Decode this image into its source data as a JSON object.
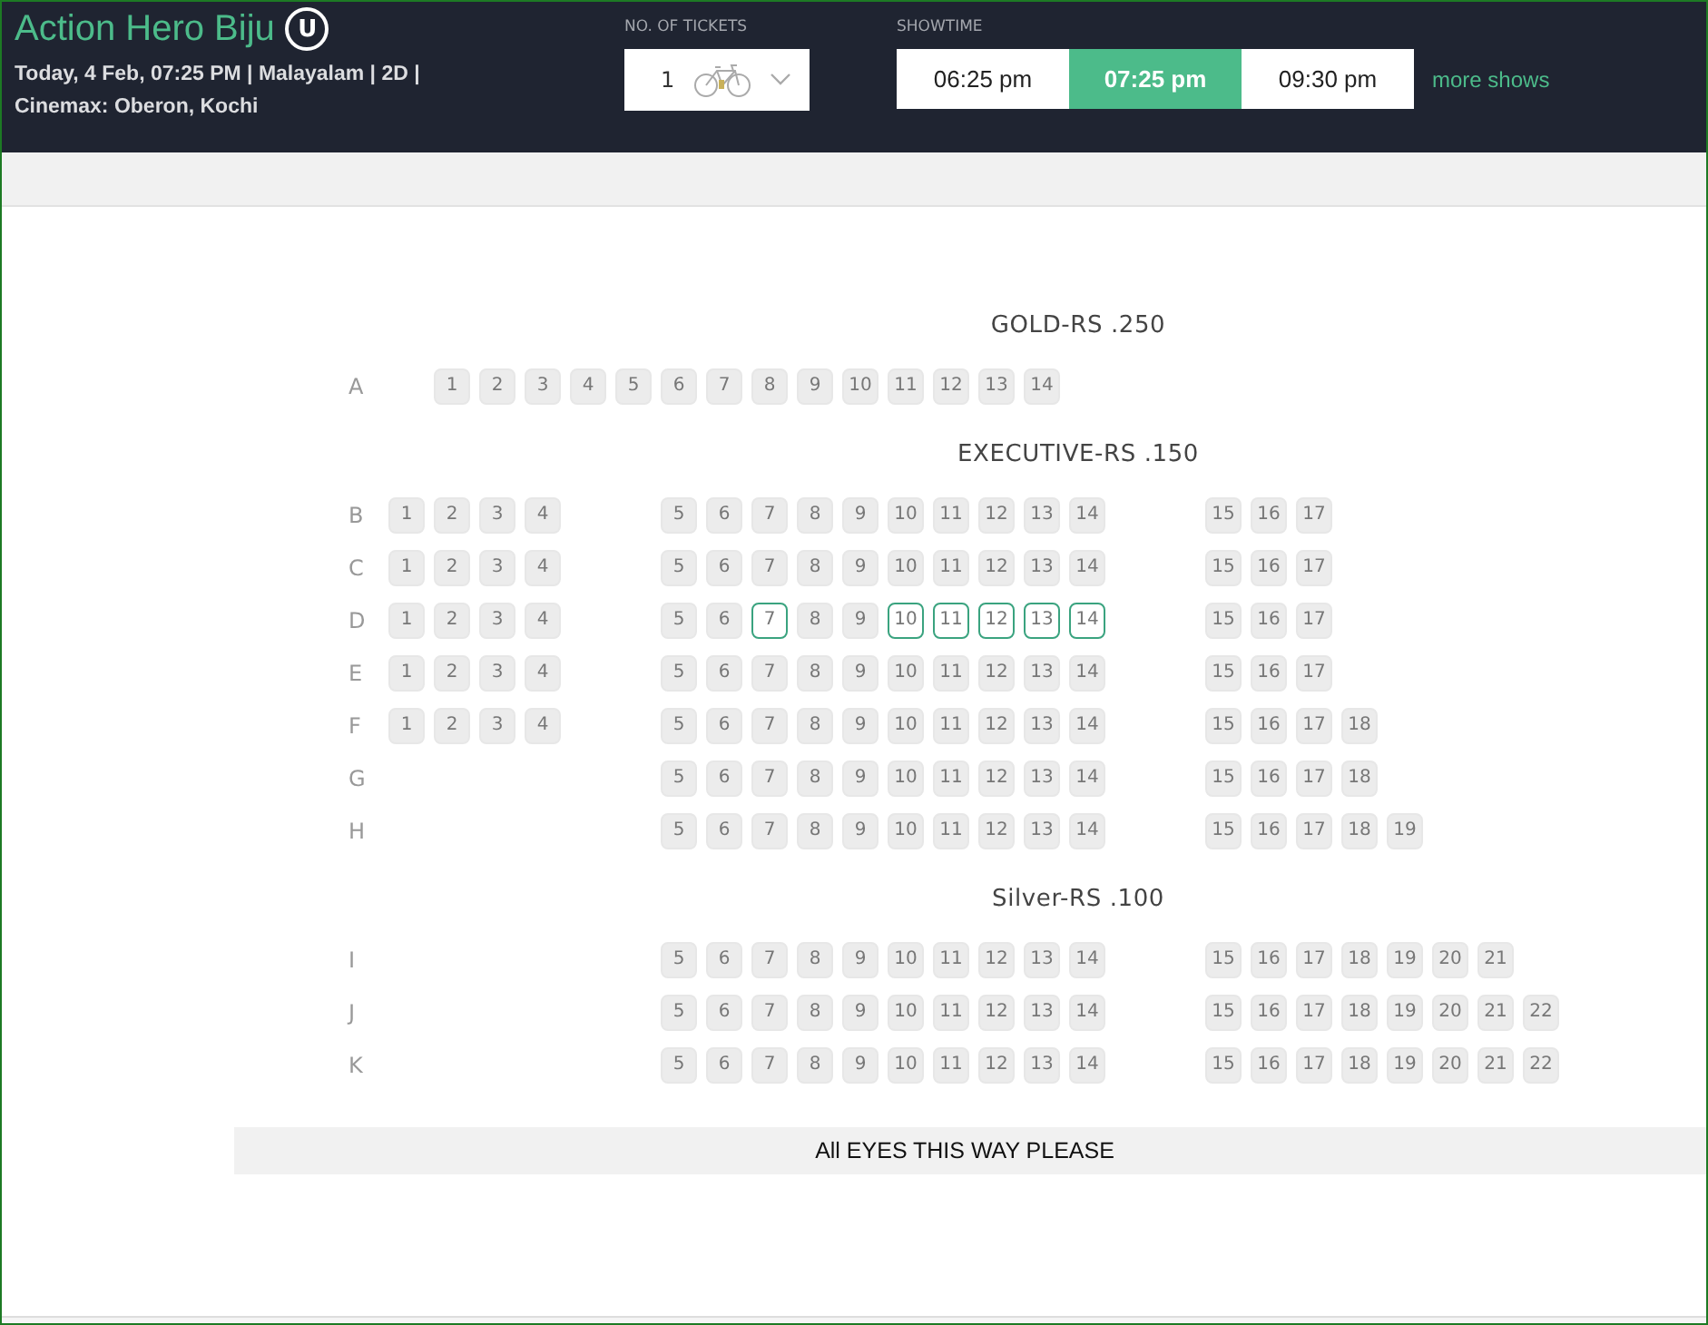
{
  "movie": {
    "title": "Action Hero Biju",
    "rating": "U",
    "info_line_1": "Today, 4 Feb, 07:25 PM | Malayalam | 2D |",
    "info_line_2": "Cinemax: Oberon, Kochi"
  },
  "tickets": {
    "label": "NO. OF TICKETS",
    "value": "1"
  },
  "showtime": {
    "label": "SHOWTIME",
    "times": [
      {
        "label": "06:25 pm",
        "selected": false
      },
      {
        "label": "07:25 pm",
        "selected": true
      },
      {
        "label": "09:30 pm",
        "selected": false
      }
    ],
    "more": "more shows"
  },
  "sections": [
    {
      "title": "GOLD-RS .250",
      "rows": [
        {
          "label": "A",
          "groups": [
            {
              "kind": "full",
              "seats": [
                {
                  "n": "1",
                  "available": false
                },
                {
                  "n": "2",
                  "available": false
                },
                {
                  "n": "3",
                  "available": false
                },
                {
                  "n": "4",
                  "available": false
                },
                {
                  "n": "5",
                  "available": false
                },
                {
                  "n": "6",
                  "available": false
                },
                {
                  "n": "7",
                  "available": false
                },
                {
                  "n": "8",
                  "available": false
                },
                {
                  "n": "9",
                  "available": false
                },
                {
                  "n": "10",
                  "available": false
                },
                {
                  "n": "11",
                  "available": false
                },
                {
                  "n": "12",
                  "available": false
                },
                {
                  "n": "13",
                  "available": false
                },
                {
                  "n": "14",
                  "available": false
                }
              ]
            }
          ]
        }
      ]
    },
    {
      "title": "EXECUTIVE-RS .150",
      "rows": [
        {
          "label": "B",
          "groups": [
            {
              "kind": "left",
              "seats": [
                {
                  "n": "1",
                  "available": false
                },
                {
                  "n": "2",
                  "available": false
                },
                {
                  "n": "3",
                  "available": false
                },
                {
                  "n": "4",
                  "available": false
                }
              ]
            },
            {
              "kind": "middle",
              "seats": [
                {
                  "n": "5",
                  "available": false
                },
                {
                  "n": "6",
                  "available": false
                },
                {
                  "n": "7",
                  "available": false
                },
                {
                  "n": "8",
                  "available": false
                },
                {
                  "n": "9",
                  "available": false
                },
                {
                  "n": "10",
                  "available": false
                },
                {
                  "n": "11",
                  "available": false
                },
                {
                  "n": "12",
                  "available": false
                },
                {
                  "n": "13",
                  "available": false
                },
                {
                  "n": "14",
                  "available": false
                }
              ]
            },
            {
              "kind": "right",
              "seats": [
                {
                  "n": "15",
                  "available": false
                },
                {
                  "n": "16",
                  "available": false
                },
                {
                  "n": "17",
                  "available": false
                }
              ]
            }
          ]
        },
        {
          "label": "C",
          "groups": [
            {
              "kind": "left",
              "seats": [
                {
                  "n": "1",
                  "available": false
                },
                {
                  "n": "2",
                  "available": false
                },
                {
                  "n": "3",
                  "available": false
                },
                {
                  "n": "4",
                  "available": false
                }
              ]
            },
            {
              "kind": "middle",
              "seats": [
                {
                  "n": "5",
                  "available": false
                },
                {
                  "n": "6",
                  "available": false
                },
                {
                  "n": "7",
                  "available": false
                },
                {
                  "n": "8",
                  "available": false
                },
                {
                  "n": "9",
                  "available": false
                },
                {
                  "n": "10",
                  "available": false
                },
                {
                  "n": "11",
                  "available": false
                },
                {
                  "n": "12",
                  "available": false
                },
                {
                  "n": "13",
                  "available": false
                },
                {
                  "n": "14",
                  "available": false
                }
              ]
            },
            {
              "kind": "right",
              "seats": [
                {
                  "n": "15",
                  "available": false
                },
                {
                  "n": "16",
                  "available": false
                },
                {
                  "n": "17",
                  "available": false
                }
              ]
            }
          ]
        },
        {
          "label": "D",
          "groups": [
            {
              "kind": "left",
              "seats": [
                {
                  "n": "1",
                  "available": false
                },
                {
                  "n": "2",
                  "available": false
                },
                {
                  "n": "3",
                  "available": false
                },
                {
                  "n": "4",
                  "available": false
                }
              ]
            },
            {
              "kind": "middle",
              "seats": [
                {
                  "n": "5",
                  "available": false
                },
                {
                  "n": "6",
                  "available": false
                },
                {
                  "n": "7",
                  "available": true
                },
                {
                  "n": "8",
                  "available": false
                },
                {
                  "n": "9",
                  "available": false
                },
                {
                  "n": "10",
                  "available": true
                },
                {
                  "n": "11",
                  "available": true
                },
                {
                  "n": "12",
                  "available": true
                },
                {
                  "n": "13",
                  "available": true
                },
                {
                  "n": "14",
                  "available": true
                }
              ]
            },
            {
              "kind": "right",
              "seats": [
                {
                  "n": "15",
                  "available": false
                },
                {
                  "n": "16",
                  "available": false
                },
                {
                  "n": "17",
                  "available": false
                }
              ]
            }
          ]
        },
        {
          "label": "E",
          "groups": [
            {
              "kind": "left",
              "seats": [
                {
                  "n": "1",
                  "available": false
                },
                {
                  "n": "2",
                  "available": false
                },
                {
                  "n": "3",
                  "available": false
                },
                {
                  "n": "4",
                  "available": false
                }
              ]
            },
            {
              "kind": "middle",
              "seats": [
                {
                  "n": "5",
                  "available": false
                },
                {
                  "n": "6",
                  "available": false
                },
                {
                  "n": "7",
                  "available": false
                },
                {
                  "n": "8",
                  "available": false
                },
                {
                  "n": "9",
                  "available": false
                },
                {
                  "n": "10",
                  "available": false
                },
                {
                  "n": "11",
                  "available": false
                },
                {
                  "n": "12",
                  "available": false
                },
                {
                  "n": "13",
                  "available": false
                },
                {
                  "n": "14",
                  "available": false
                }
              ]
            },
            {
              "kind": "right",
              "seats": [
                {
                  "n": "15",
                  "available": false
                },
                {
                  "n": "16",
                  "available": false
                },
                {
                  "n": "17",
                  "available": false
                }
              ]
            }
          ]
        },
        {
          "label": "F",
          "groups": [
            {
              "kind": "left",
              "seats": [
                {
                  "n": "1",
                  "available": false
                },
                {
                  "n": "2",
                  "available": false
                },
                {
                  "n": "3",
                  "available": false
                },
                {
                  "n": "4",
                  "available": false
                }
              ]
            },
            {
              "kind": "middle",
              "seats": [
                {
                  "n": "5",
                  "available": false
                },
                {
                  "n": "6",
                  "available": false
                },
                {
                  "n": "7",
                  "available": false
                },
                {
                  "n": "8",
                  "available": false
                },
                {
                  "n": "9",
                  "available": false
                },
                {
                  "n": "10",
                  "available": false
                },
                {
                  "n": "11",
                  "available": false
                },
                {
                  "n": "12",
                  "available": false
                },
                {
                  "n": "13",
                  "available": false
                },
                {
                  "n": "14",
                  "available": false
                }
              ]
            },
            {
              "kind": "right",
              "seats": [
                {
                  "n": "15",
                  "available": false
                },
                {
                  "n": "16",
                  "available": false
                },
                {
                  "n": "17",
                  "available": false
                },
                {
                  "n": "18",
                  "available": false
                }
              ]
            }
          ]
        },
        {
          "label": "G",
          "groups": [
            {
              "kind": "middle",
              "seats": [
                {
                  "n": "5",
                  "available": false
                },
                {
                  "n": "6",
                  "available": false
                },
                {
                  "n": "7",
                  "available": false
                },
                {
                  "n": "8",
                  "available": false
                },
                {
                  "n": "9",
                  "available": false
                },
                {
                  "n": "10",
                  "available": false
                },
                {
                  "n": "11",
                  "available": false
                },
                {
                  "n": "12",
                  "available": false
                },
                {
                  "n": "13",
                  "available": false
                },
                {
                  "n": "14",
                  "available": false
                }
              ]
            },
            {
              "kind": "right",
              "seats": [
                {
                  "n": "15",
                  "available": false
                },
                {
                  "n": "16",
                  "available": false
                },
                {
                  "n": "17",
                  "available": false
                },
                {
                  "n": "18",
                  "available": false
                }
              ]
            }
          ]
        },
        {
          "label": "H",
          "groups": [
            {
              "kind": "middle",
              "seats": [
                {
                  "n": "5",
                  "available": false
                },
                {
                  "n": "6",
                  "available": false
                },
                {
                  "n": "7",
                  "available": false
                },
                {
                  "n": "8",
                  "available": false
                },
                {
                  "n": "9",
                  "available": false
                },
                {
                  "n": "10",
                  "available": false
                },
                {
                  "n": "11",
                  "available": false
                },
                {
                  "n": "12",
                  "available": false
                },
                {
                  "n": "13",
                  "available": false
                },
                {
                  "n": "14",
                  "available": false
                }
              ]
            },
            {
              "kind": "right",
              "seats": [
                {
                  "n": "15",
                  "available": false
                },
                {
                  "n": "16",
                  "available": false
                },
                {
                  "n": "17",
                  "available": false
                },
                {
                  "n": "18",
                  "available": false
                },
                {
                  "n": "19",
                  "available": false
                }
              ]
            }
          ]
        }
      ]
    },
    {
      "title": "Silver-RS .100",
      "rows": [
        {
          "label": "I",
          "groups": [
            {
              "kind": "middle",
              "seats": [
                {
                  "n": "5",
                  "available": false
                },
                {
                  "n": "6",
                  "available": false
                },
                {
                  "n": "7",
                  "available": false
                },
                {
                  "n": "8",
                  "available": false
                },
                {
                  "n": "9",
                  "available": false
                },
                {
                  "n": "10",
                  "available": false
                },
                {
                  "n": "11",
                  "available": false
                },
                {
                  "n": "12",
                  "available": false
                },
                {
                  "n": "13",
                  "available": false
                },
                {
                  "n": "14",
                  "available": false
                }
              ]
            },
            {
              "kind": "right",
              "seats": [
                {
                  "n": "15",
                  "available": false
                },
                {
                  "n": "16",
                  "available": false
                },
                {
                  "n": "17",
                  "available": false
                },
                {
                  "n": "18",
                  "available": false
                },
                {
                  "n": "19",
                  "available": false
                },
                {
                  "n": "20",
                  "available": false
                },
                {
                  "n": "21",
                  "available": false
                }
              ]
            }
          ]
        },
        {
          "label": "J",
          "groups": [
            {
              "kind": "middle",
              "seats": [
                {
                  "n": "5",
                  "available": false
                },
                {
                  "n": "6",
                  "available": false
                },
                {
                  "n": "7",
                  "available": false
                },
                {
                  "n": "8",
                  "available": false
                },
                {
                  "n": "9",
                  "available": false
                },
                {
                  "n": "10",
                  "available": false
                },
                {
                  "n": "11",
                  "available": false
                },
                {
                  "n": "12",
                  "available": false
                },
                {
                  "n": "13",
                  "available": false
                },
                {
                  "n": "14",
                  "available": false
                }
              ]
            },
            {
              "kind": "right",
              "seats": [
                {
                  "n": "15",
                  "available": false
                },
                {
                  "n": "16",
                  "available": false
                },
                {
                  "n": "17",
                  "available": false
                },
                {
                  "n": "18",
                  "available": false
                },
                {
                  "n": "19",
                  "available": false
                },
                {
                  "n": "20",
                  "available": false
                },
                {
                  "n": "21",
                  "available": false
                },
                {
                  "n": "22",
                  "available": false
                }
              ]
            }
          ]
        },
        {
          "label": "K",
          "groups": [
            {
              "kind": "middle",
              "seats": [
                {
                  "n": "5",
                  "available": false
                },
                {
                  "n": "6",
                  "available": false
                },
                {
                  "n": "7",
                  "available": false
                },
                {
                  "n": "8",
                  "available": false
                },
                {
                  "n": "9",
                  "available": false
                },
                {
                  "n": "10",
                  "available": false
                },
                {
                  "n": "11",
                  "available": false
                },
                {
                  "n": "12",
                  "available": false
                },
                {
                  "n": "13",
                  "available": false
                },
                {
                  "n": "14",
                  "available": false
                }
              ]
            },
            {
              "kind": "right",
              "seats": [
                {
                  "n": "15",
                  "available": false
                },
                {
                  "n": "16",
                  "available": false
                },
                {
                  "n": "17",
                  "available": false
                },
                {
                  "n": "18",
                  "available": false
                },
                {
                  "n": "19",
                  "available": false
                },
                {
                  "n": "20",
                  "available": false
                },
                {
                  "n": "21",
                  "available": false
                },
                {
                  "n": "22",
                  "available": false
                }
              ]
            }
          ]
        }
      ]
    }
  ],
  "screen": "All EYES THIS WAY PLEASE"
}
